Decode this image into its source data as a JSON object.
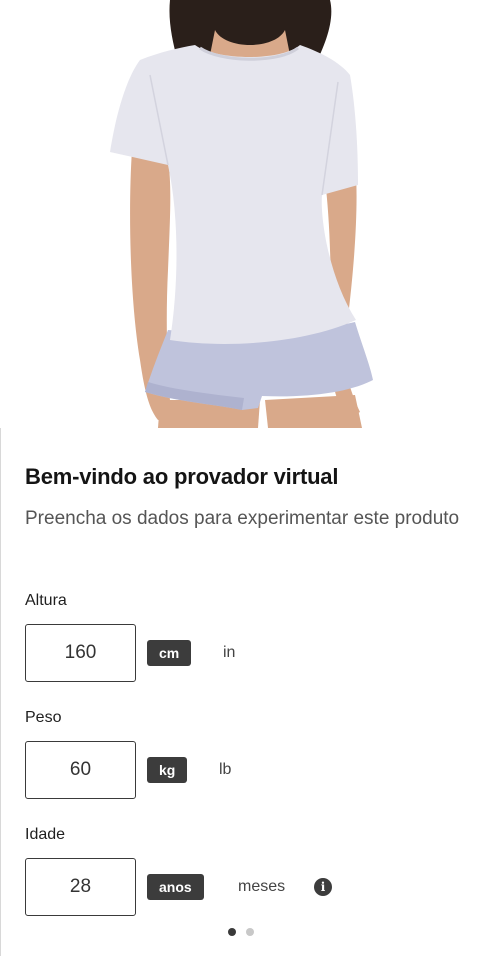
{
  "hero": {
    "colors": {
      "background": "#ffffff",
      "shirt": "#e6e6ee",
      "shorts": "#bfc3dc",
      "skin": "#d9a98a",
      "hair": "#2a1f1a"
    }
  },
  "form": {
    "title": "Bem-vindo ao provador virtual",
    "subtitle": "Preencha os dados para experimentar este produto",
    "height": {
      "label": "Altura",
      "value": "160",
      "unit_active": "cm",
      "unit_inactive": "in"
    },
    "weight": {
      "label": "Peso",
      "value": "60",
      "unit_active": "kg",
      "unit_inactive": "lb"
    },
    "age": {
      "label": "Idade",
      "value": "28",
      "unit_active": "anos",
      "unit_inactive": "meses",
      "info_icon": "info-icon"
    }
  },
  "pagination": {
    "current": 1,
    "total": 2
  },
  "colors": {
    "accent": "#3c3c3c",
    "text": "#141414",
    "muted": "#555555",
    "dot_inactive": "#c8c8c8"
  }
}
